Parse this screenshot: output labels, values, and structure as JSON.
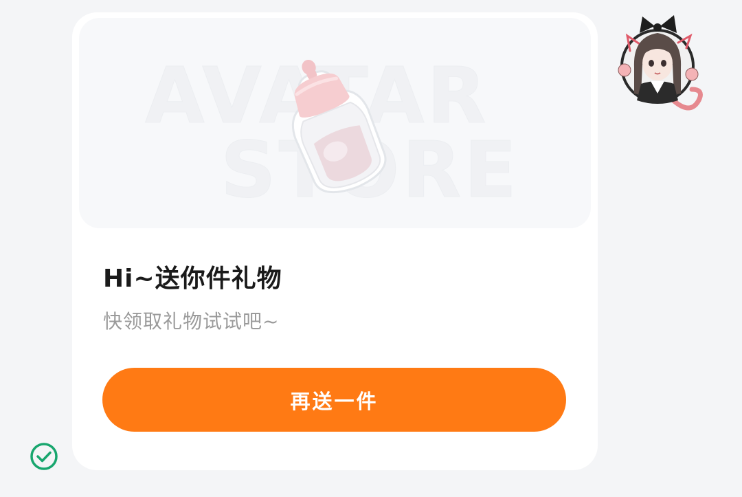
{
  "card": {
    "hero": {
      "watermark_line1": "AVATAR",
      "watermark_line2": "STORE",
      "image": "baby-bottle-gift-icon"
    },
    "title": "Hi~送你件礼物",
    "subtitle": "快领取礼物试试吧~",
    "cta_label": "再送一件"
  },
  "avatar": {
    "icon": "anime-cat-girl-avatar"
  },
  "status": {
    "icon": "check-circle-icon"
  },
  "colors": {
    "accent": "#ff7a14",
    "check": "#18a66e",
    "bottle_cap": "#f4c9cc",
    "background": "#f4f5f7"
  }
}
